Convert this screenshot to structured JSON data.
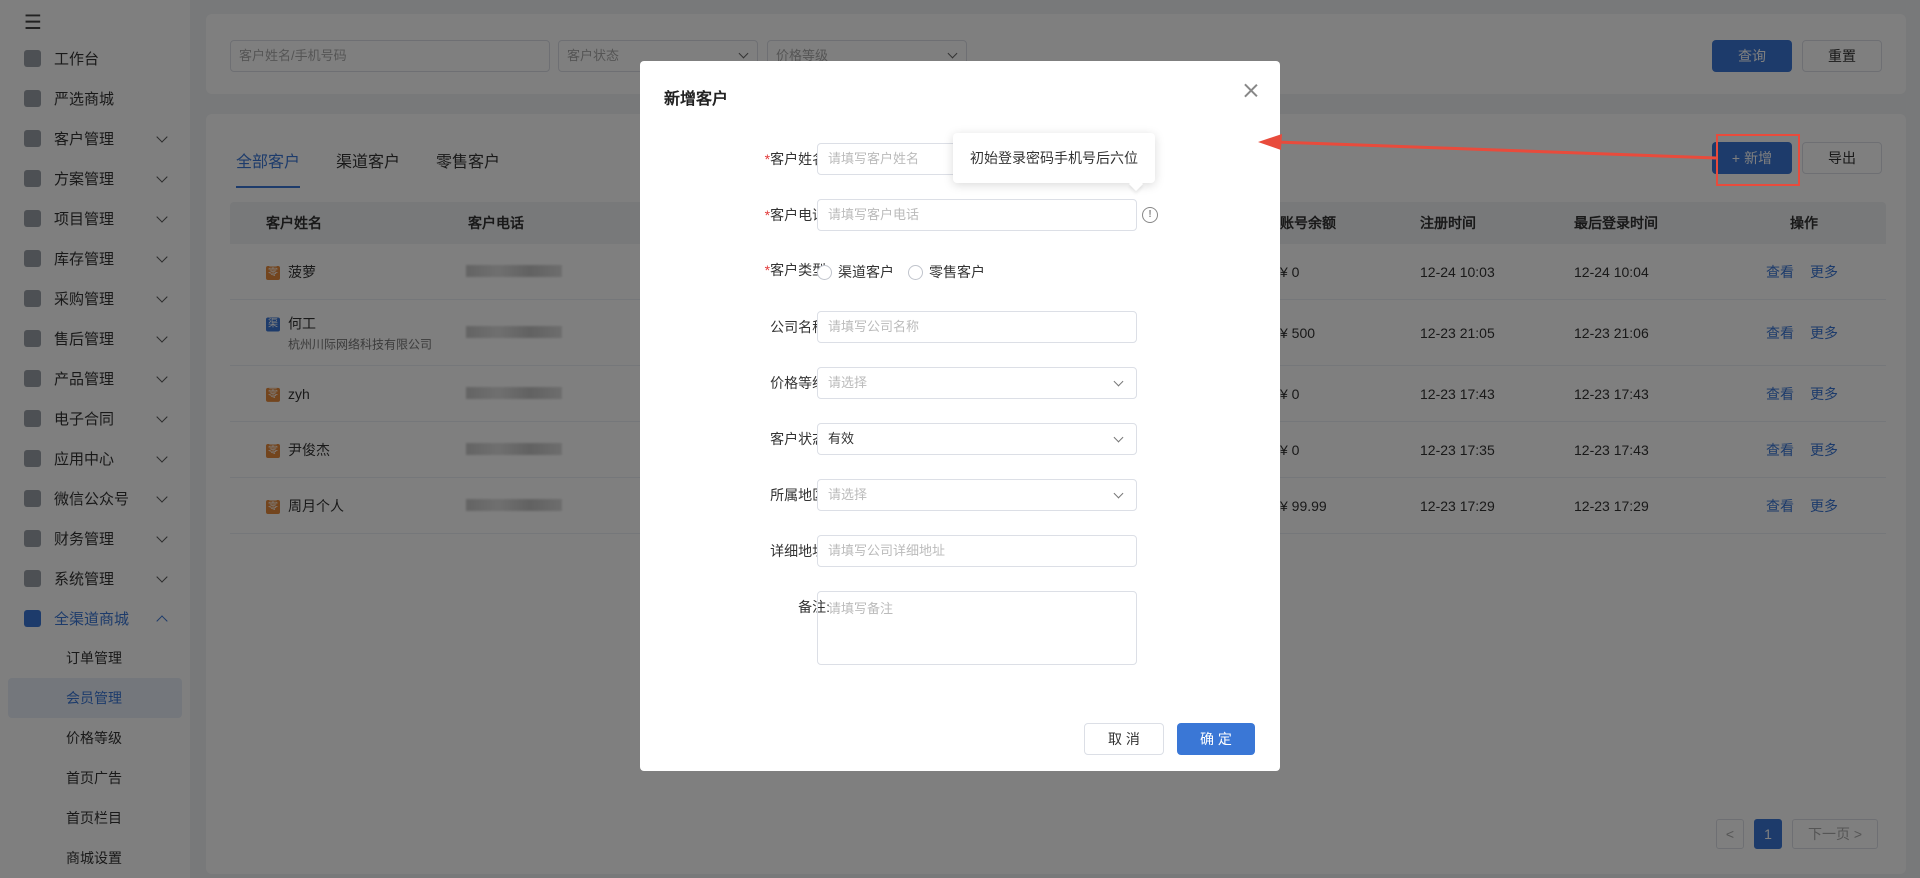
{
  "sidebar": {
    "menu": [
      {
        "label": "工作台",
        "icon": "home-icon",
        "chevron": false
      },
      {
        "label": "严选商城",
        "icon": "shop-icon",
        "chevron": false
      },
      {
        "label": "客户管理",
        "icon": "customer-icon",
        "chevron": true
      },
      {
        "label": "方案管理",
        "icon": "plan-icon",
        "chevron": true
      },
      {
        "label": "项目管理",
        "icon": "folder-icon",
        "chevron": true
      },
      {
        "label": "库存管理",
        "icon": "inventory-icon",
        "chevron": true
      },
      {
        "label": "采购管理",
        "icon": "cart-icon",
        "chevron": true
      },
      {
        "label": "售后管理",
        "icon": "headset-icon",
        "chevron": true
      },
      {
        "label": "产品管理",
        "icon": "product-icon",
        "chevron": true
      },
      {
        "label": "电子合同",
        "icon": "contract-icon",
        "chevron": true
      },
      {
        "label": "应用中心",
        "icon": "apps-icon",
        "chevron": true
      },
      {
        "label": "微信公众号",
        "icon": "wechat-icon",
        "chevron": true
      },
      {
        "label": "财务管理",
        "icon": "finance-icon",
        "chevron": true
      },
      {
        "label": "系统管理",
        "icon": "settings-icon",
        "chevron": true
      },
      {
        "label": "全渠道商城",
        "icon": "mall-icon",
        "chevron": true,
        "open": true
      }
    ],
    "submenu": [
      {
        "label": "订单管理"
      },
      {
        "label": "会员管理",
        "active": true
      },
      {
        "label": "价格等级"
      },
      {
        "label": "首页广告"
      },
      {
        "label": "首页栏目"
      },
      {
        "label": "商城设置"
      }
    ]
  },
  "search": {
    "name_placeholder": "客户姓名/手机号码",
    "status_placeholder": "客户状态",
    "price_placeholder": "价格等级",
    "query_label": "查询",
    "reset_label": "重置"
  },
  "list": {
    "tabs": [
      "全部客户",
      "渠道客户",
      "零售客户"
    ],
    "add_label": "新增",
    "export_label": "导出",
    "columns": {
      "name": "客户姓名",
      "phone": "客户电话",
      "balance": "账号余额",
      "register": "注册时间",
      "last_login": "最后登录时间",
      "actions": "操作"
    },
    "rows": [
      {
        "tag": "零",
        "name": "菠萝",
        "company": "",
        "balance": "¥ 0",
        "register": "12-24 10:03",
        "last_login": "12-24 10:04"
      },
      {
        "tag": "渠",
        "name": "何工",
        "company": "杭州川际网络科技有限公司",
        "balance": "¥ 500",
        "register": "12-23 21:05",
        "last_login": "12-23 21:06"
      },
      {
        "tag": "零",
        "name": "zyh",
        "company": "",
        "balance": "¥ 0",
        "register": "12-23 17:43",
        "last_login": "12-23 17:43"
      },
      {
        "tag": "零",
        "name": "尹俊杰",
        "company": "",
        "balance": "¥ 0",
        "register": "12-23 17:35",
        "last_login": "12-23 17:43"
      },
      {
        "tag": "零",
        "name": "周月个人",
        "company": "",
        "balance": "¥ 99.99",
        "register": "12-23 17:29",
        "last_login": "12-23 17:29"
      }
    ],
    "view_label": "查看",
    "more_label": "更多",
    "pager": {
      "prev": "<",
      "current": "1",
      "next": "下一页 >"
    }
  },
  "modal": {
    "title": "新增客户",
    "tooltip": "初始登录密码手机号后六位",
    "fields": {
      "name": {
        "label": "客户姓名:",
        "placeholder": "请填写客户姓名"
      },
      "phone": {
        "label": "客户电话:",
        "placeholder": "请填写客户电话"
      },
      "type": {
        "label": "客户类型:",
        "options": [
          "渠道客户",
          "零售客户"
        ]
      },
      "company": {
        "label": "公司名称:",
        "placeholder": "请填写公司名称"
      },
      "price_level": {
        "label": "价格等级:",
        "placeholder": "请选择"
      },
      "status": {
        "label": "客户状态:",
        "value": "有效"
      },
      "region": {
        "label": "所属地区:",
        "placeholder": "请选择"
      },
      "address": {
        "label": "详细地址:",
        "placeholder": "请填写公司详细地址"
      },
      "remark": {
        "label": "备注:",
        "placeholder": "请填写备注"
      }
    },
    "cancel_label": "取 消",
    "confirm_label": "确 定"
  },
  "colors": {
    "primary": "#3a77d6",
    "annotation": "#e84b3c",
    "required": "#e23b3b"
  }
}
